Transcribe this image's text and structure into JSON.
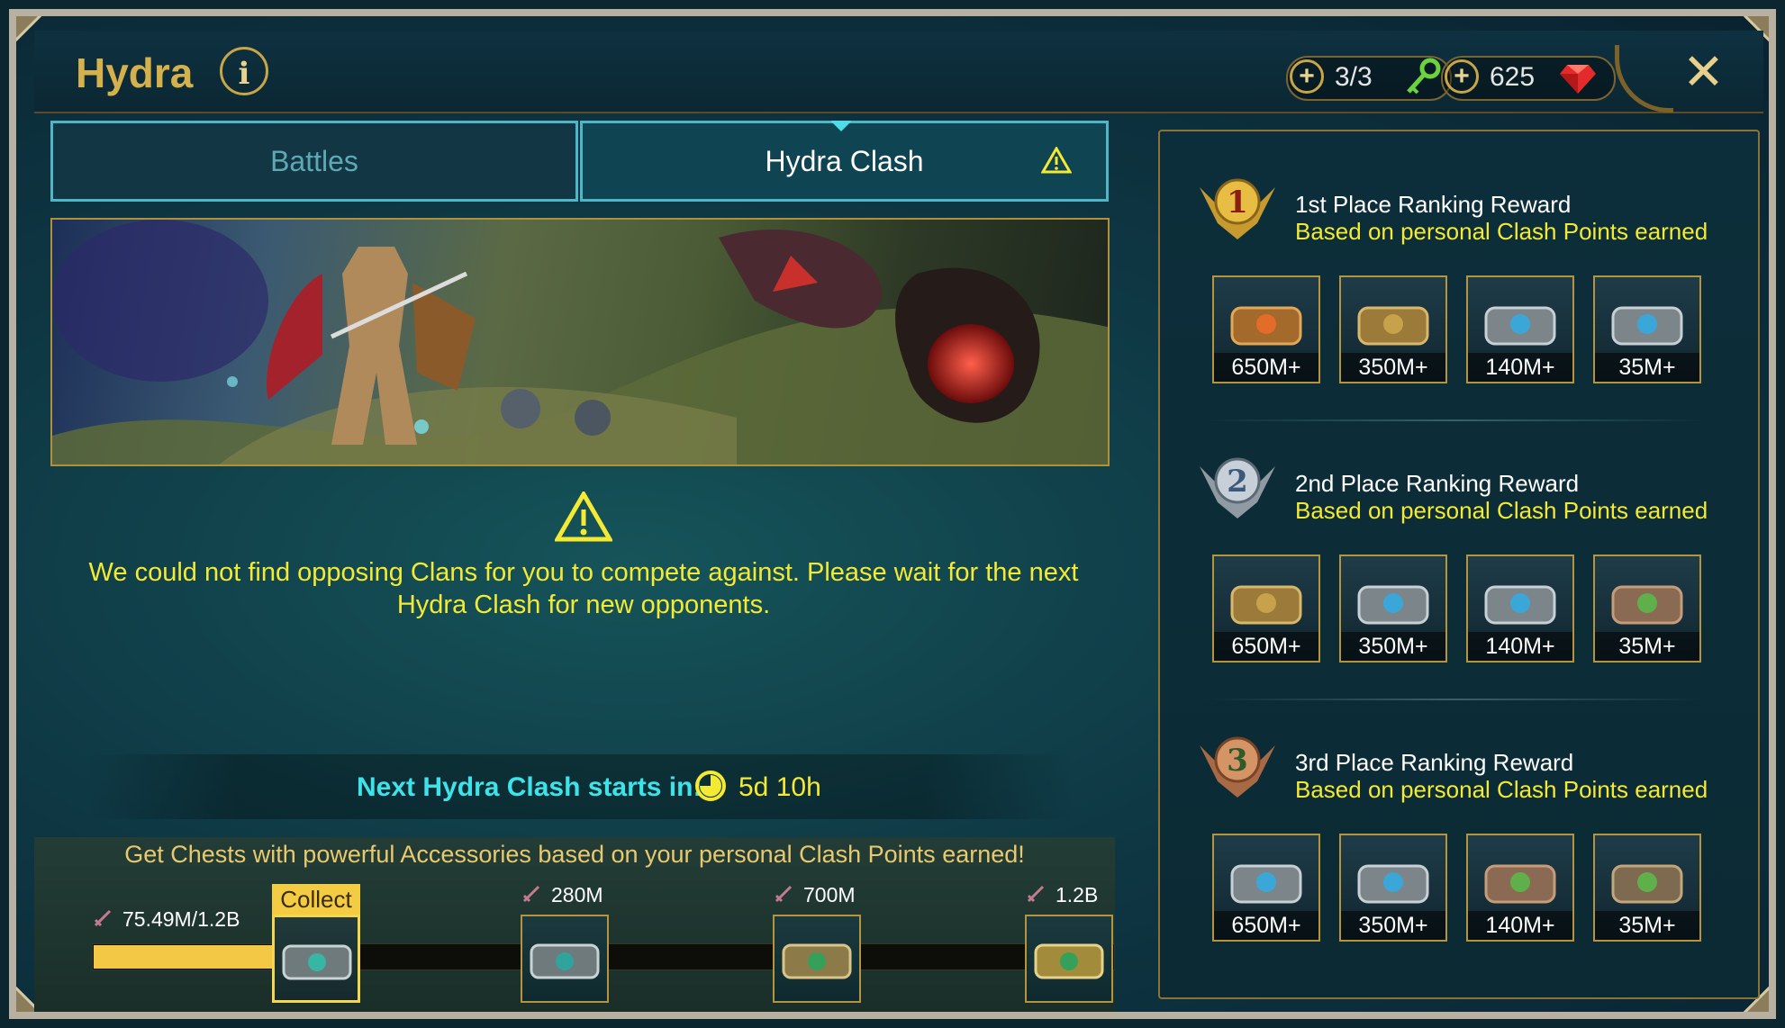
{
  "header": {
    "title": "Hydra",
    "info_label": "i",
    "keys": "3/3",
    "gems": "625",
    "close_label": "✕"
  },
  "tabs": [
    {
      "label": "Battles"
    },
    {
      "label": "Hydra Clash"
    }
  ],
  "main": {
    "message": "We could not find opposing Clans for you to compete against. Please wait for the next Hydra Clash for new opponents.",
    "next_label": "Next Hydra Clash starts in:",
    "next_time": "5d 10h",
    "chest_info": "Get Chests with powerful Accessories based on your personal Clash Points earned!"
  },
  "progress": {
    "current": "75.49M/1.2B",
    "fraction": 0.063,
    "collect_label": "Collect",
    "milestones": [
      "280M",
      "700M",
      "1.2B"
    ]
  },
  "rankings": [
    {
      "title": "1st Place Ranking Reward",
      "subtitle": "Based on personal Clash Points earned",
      "rewards": [
        "650M+",
        "350M+",
        "140M+",
        "35M+"
      ]
    },
    {
      "title": "2nd Place Ranking Reward",
      "subtitle": "Based on personal Clash Points earned",
      "rewards": [
        "650M+",
        "350M+",
        "140M+",
        "35M+"
      ]
    },
    {
      "title": "3rd Place Ranking Reward",
      "subtitle": "Based on personal Clash Points earned",
      "rewards": [
        "650M+",
        "350M+",
        "140M+",
        "35M+"
      ]
    }
  ],
  "colors": {
    "accent_gold": "#d4b14d",
    "warning_yellow": "#f4e933",
    "cyan": "#3ee3ea"
  }
}
